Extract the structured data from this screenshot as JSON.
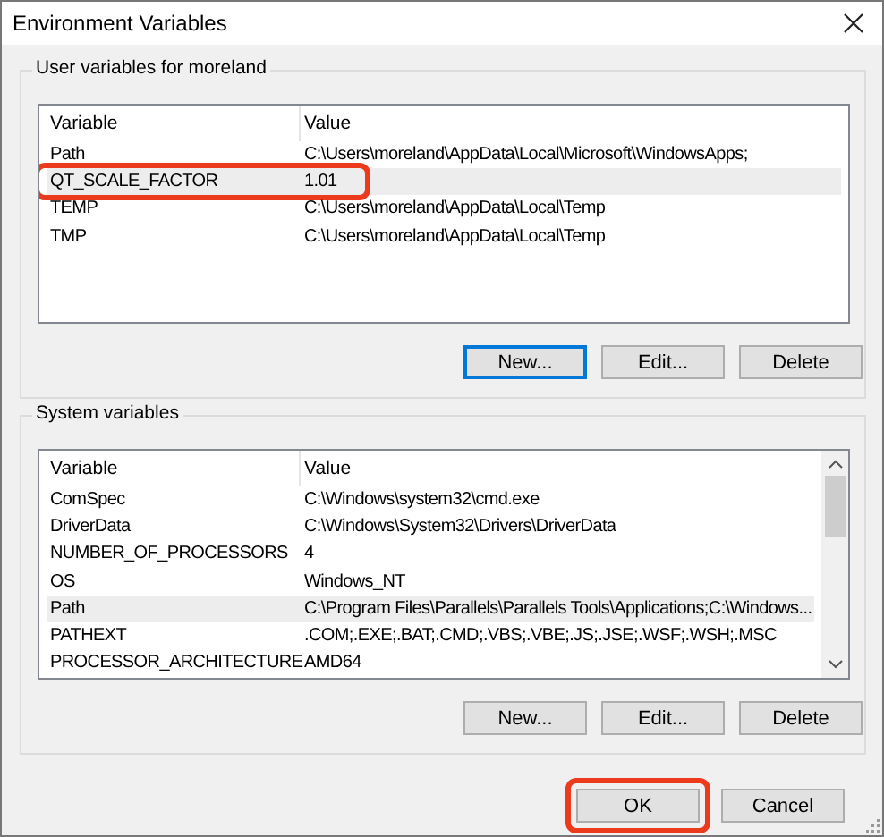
{
  "window": {
    "title": "Environment Variables"
  },
  "user_variables": {
    "title": "User variables for moreland",
    "columns": [
      "Variable",
      "Value"
    ],
    "rows": [
      {
        "variable": "Path",
        "value": "C:\\Users\\moreland\\AppData\\Local\\Microsoft\\WindowsApps;",
        "selected": false,
        "highlighted": false
      },
      {
        "variable": "QT_SCALE_FACTOR",
        "value": "1.01",
        "selected": true,
        "highlighted": true
      },
      {
        "variable": "TEMP",
        "value": "C:\\Users\\moreland\\AppData\\Local\\Temp",
        "selected": false,
        "highlighted": false
      },
      {
        "variable": "TMP",
        "value": "C:\\Users\\moreland\\AppData\\Local\\Temp",
        "selected": false,
        "highlighted": false
      }
    ],
    "buttons": [
      {
        "label": "New...",
        "focused": true
      },
      {
        "label": "Edit...",
        "focused": false
      },
      {
        "label": "Delete",
        "focused": false
      }
    ]
  },
  "system_variables": {
    "title": "System variables",
    "columns": [
      "Variable",
      "Value"
    ],
    "rows": [
      {
        "variable": "ComSpec",
        "value": "C:\\Windows\\system32\\cmd.exe",
        "selected": false,
        "highlighted": false
      },
      {
        "variable": "DriverData",
        "value": "C:\\Windows\\System32\\Drivers\\DriverData",
        "selected": false,
        "highlighted": false
      },
      {
        "variable": "NUMBER_OF_PROCESSORS",
        "value": "4",
        "selected": false,
        "highlighted": false
      },
      {
        "variable": "OS",
        "value": "Windows_NT",
        "selected": false,
        "highlighted": false
      },
      {
        "variable": "Path",
        "value": "C:\\Program Files\\Parallels\\Parallels Tools\\Applications;C:\\Windows...",
        "selected": true,
        "highlighted": false
      },
      {
        "variable": "PATHEXT",
        "value": ".COM;.EXE;.BAT;.CMD;.VBS;.VBE;.JS;.JSE;.WSF;.WSH;.MSC",
        "selected": false,
        "highlighted": false
      },
      {
        "variable": "PROCESSOR_ARCHITECTURE",
        "value": "AMD64",
        "selected": false,
        "highlighted": false
      }
    ],
    "buttons": [
      {
        "label": "New...",
        "focused": false
      },
      {
        "label": "Edit...",
        "focused": false
      },
      {
        "label": "Delete",
        "focused": false
      }
    ]
  },
  "footer_buttons": [
    {
      "label": "OK",
      "highlighted": true
    },
    {
      "label": "Cancel",
      "highlighted": false
    }
  ]
}
